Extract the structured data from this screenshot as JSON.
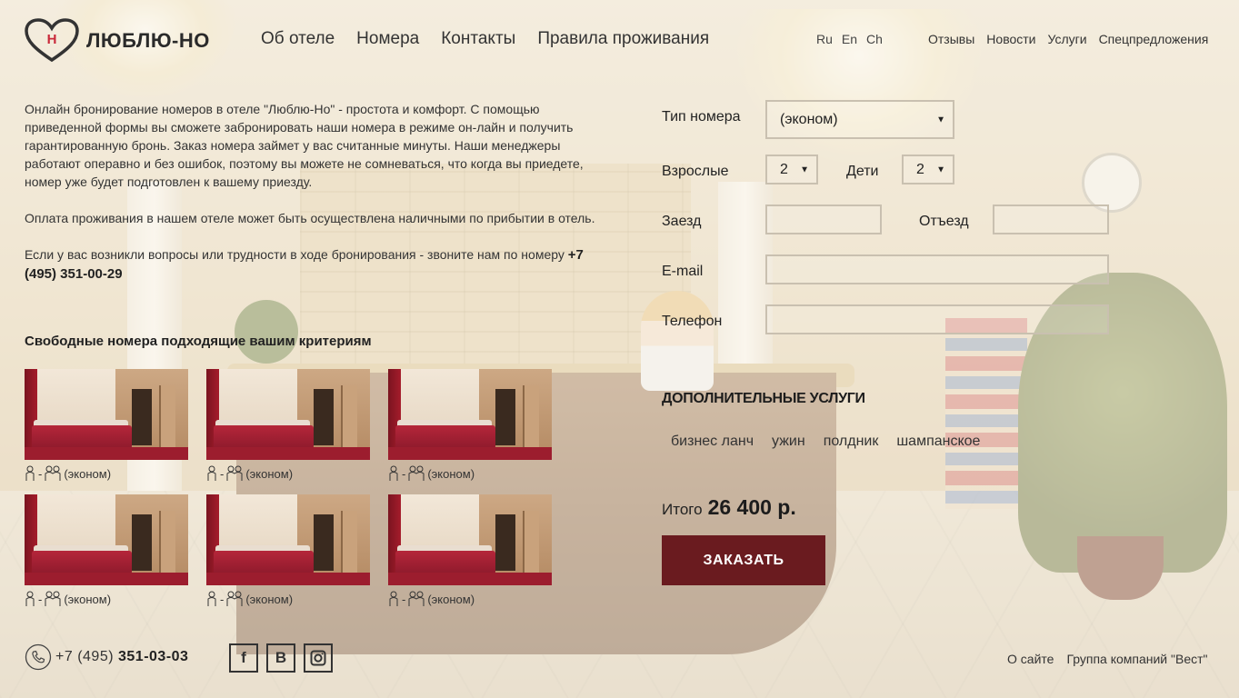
{
  "header": {
    "logo_text": "ЛЮБЛЮ-НО",
    "main_nav": [
      "Об отеле",
      "Номера",
      "Контакты",
      "Правила проживания"
    ],
    "languages": [
      "Ru",
      "En",
      "Ch"
    ],
    "secondary_nav": [
      "Отзывы",
      "Новости",
      "Услуги",
      "Спецпредложения"
    ]
  },
  "intro": {
    "p1": "Онлайн бронирование номеров в отеле \"Люблю-Но\" - простота и комфорт. С помощью приведенной формы вы сможете забронировать наши номера в режиме он-лайн и получить гарантированную бронь. Заказ номера займет у вас считанные минуты. Наши менеджеры работают операвно и без ошибок, поэтому вы можете не сомневаться, что когда вы приедете, номер уже будет подготовлен к вашему приезду.",
    "p2": "Оплата проживания в нашем отеле может быть осуществлена наличными по прибытии в отель.",
    "p3": "Если у вас возникли вопросы или трудности в ходе бронирования - звоните нам по номеру",
    "p3_phone": "+7 (495) 351-00-29"
  },
  "rooms": {
    "title": "Свободные номера подходящие вашим критериям",
    "items": [
      {
        "caption": "(эконом)"
      },
      {
        "caption": "(эконом)"
      },
      {
        "caption": "(эконом)"
      },
      {
        "caption": "(эконом)"
      },
      {
        "caption": "(эконом)"
      },
      {
        "caption": "(эконом)"
      }
    ]
  },
  "form": {
    "room_type_label": "Тип номера",
    "room_type_value": "(эконом)",
    "adults_label": "Взрослые",
    "adults_value": "2",
    "children_label": "Дети",
    "children_value": "2",
    "checkin_label": "Заезд",
    "checkout_label": "Отъезд",
    "email_label": "E-mail",
    "phone_label": "Телефон",
    "extras_title": "ДОПОЛНИТЕЛЬНЫЕ УСЛУГИ",
    "extras": [
      "бизнес ланч",
      "ужин",
      "полдник",
      "шампанское"
    ],
    "total_label": "Итого",
    "total_value": "26 400 р.",
    "order_button": "ЗАКАЗАТЬ"
  },
  "footer": {
    "phone_prefix": "+7 (495)",
    "phone_number": "351-03-03",
    "social": [
      {
        "icon": "facebook-icon",
        "glyph": "f"
      },
      {
        "icon": "vk-icon",
        "glyph": "B"
      },
      {
        "icon": "instagram-icon",
        "glyph": ""
      }
    ],
    "links": [
      "О сайте",
      "Группа компаний \"Вест\""
    ]
  },
  "colors": {
    "accent": "#6a1b1f",
    "logo": "#c9293a"
  }
}
